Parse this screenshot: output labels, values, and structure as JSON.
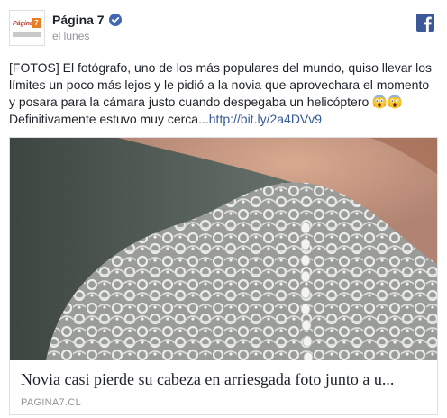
{
  "page": {
    "name": "Página 7",
    "timestamp": "el lunes",
    "avatar_text": "Página",
    "avatar_number": "7"
  },
  "post": {
    "text": "[FOTOS] El fotógrafo, uno de los más populares del mundo, quiso llevar los límites un poco más lejos y le pidió a la novia que aprovechara el momento y posara para la cámara justo cuando despegaba un helicóptero",
    "emojis": [
      "screaming-face-emoji",
      "screaming-face-emoji"
    ],
    "text_after_emoji": " Definitivamente estuvo muy cerca...",
    "link": "http://bit.ly/2a4DVv9"
  },
  "link_card": {
    "title": "Novia casi pierde su cabeza en arriesgada foto junto a u...",
    "domain": "PAGINA7.CL"
  },
  "icons": {
    "verified": "verified-badge-icon",
    "facebook": "facebook-logo-icon"
  },
  "colors": {
    "facebook_blue": "#3b5998",
    "link_blue": "#365899",
    "verified_blue": "#4267b2",
    "text": "#1d2129",
    "muted": "#90949c"
  }
}
